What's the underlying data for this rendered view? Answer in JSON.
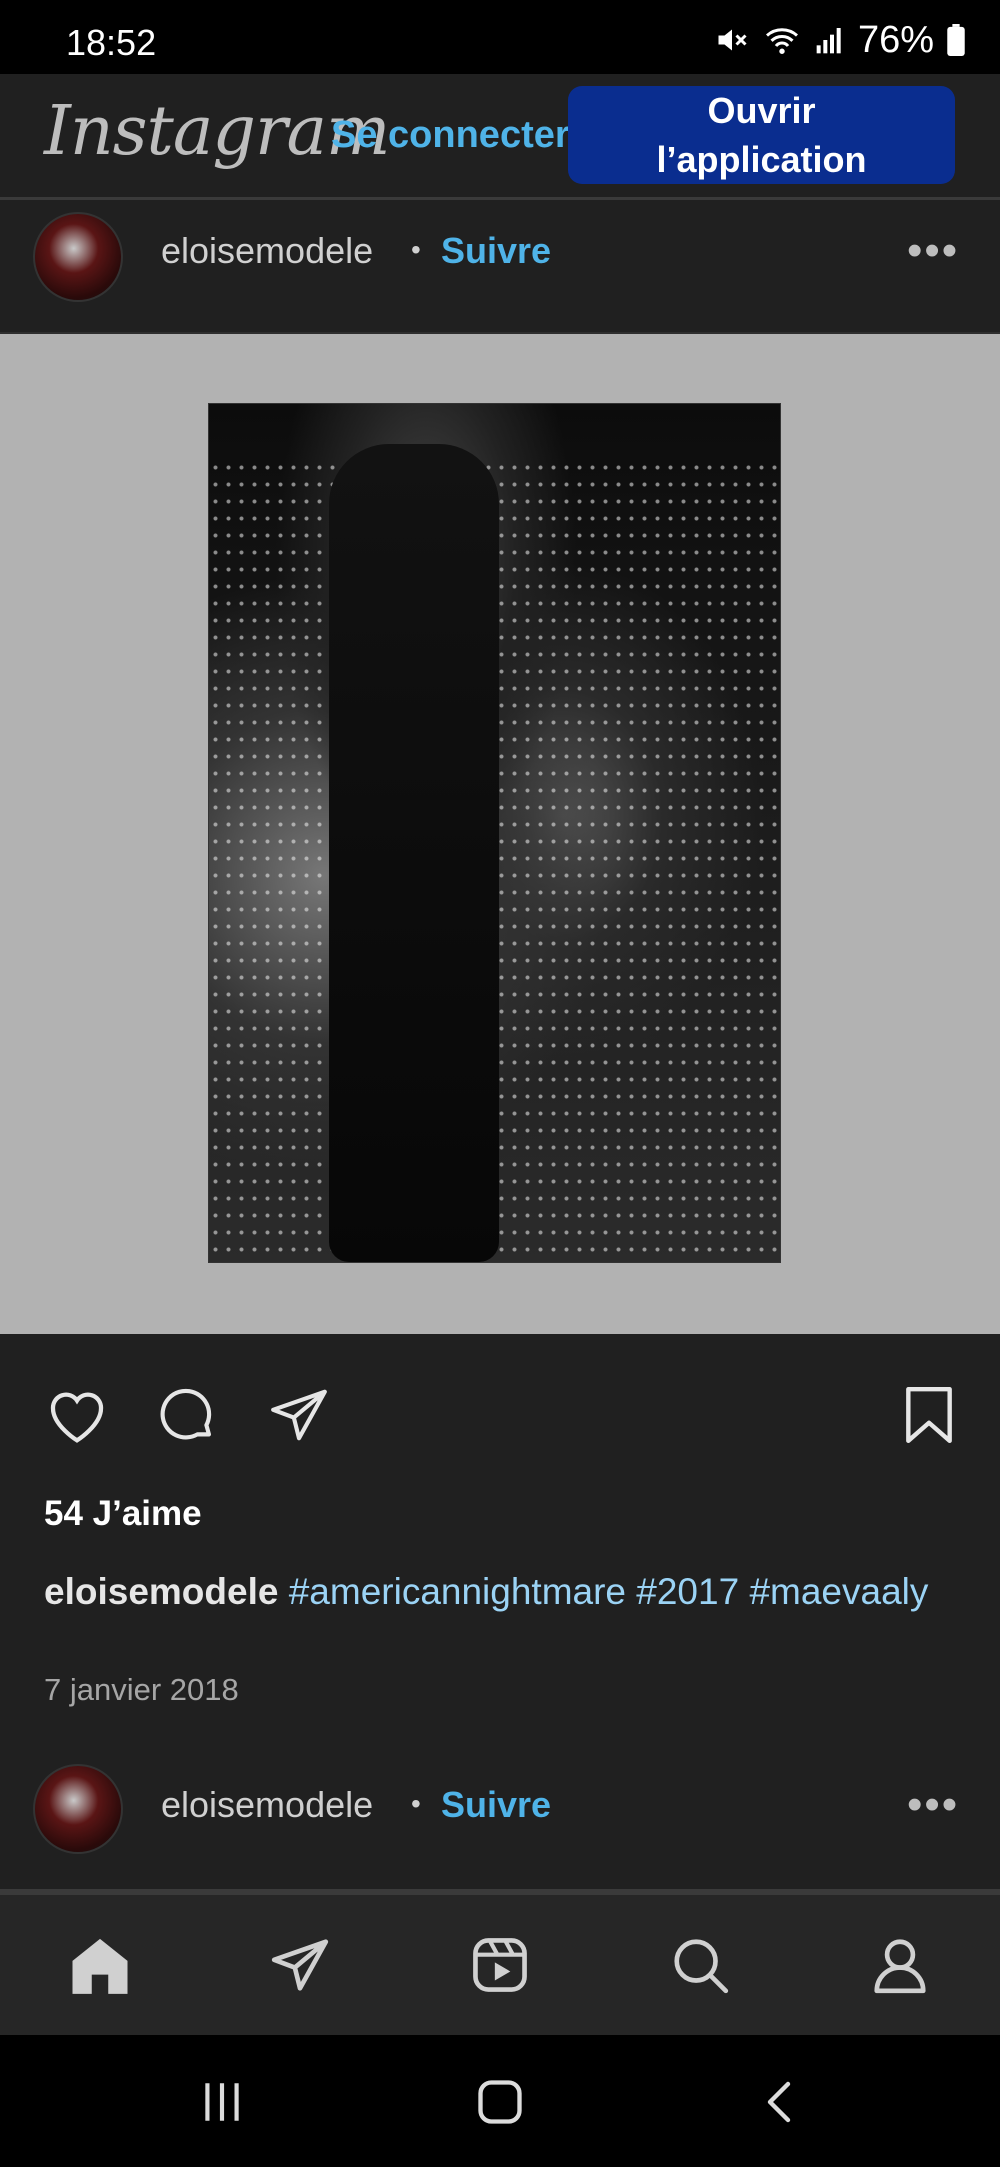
{
  "status_bar": {
    "time": "18:52",
    "battery": "76%",
    "icons": [
      "mute-icon",
      "wifi-icon",
      "signal-icon",
      "battery-icon"
    ]
  },
  "header": {
    "logo": "Instagram",
    "login_label": "Se connecter",
    "open_app_line1": "Ouvrir",
    "open_app_line2": "l’application"
  },
  "post": {
    "username": "eloisemodele",
    "separator": "•",
    "follow_label": "Suivre",
    "more": "•••",
    "likes": "54 J’aime",
    "caption_user": "eloisemodele",
    "caption_tags": "#americannightmare #2017 #maevaaly",
    "date": "7 janvier 2018"
  },
  "next_post": {
    "username": "eloisemodele",
    "separator": "•",
    "follow_label": "Suivre",
    "more": "•••"
  },
  "bottom_nav": [
    "home-icon",
    "direct-icon",
    "reels-icon",
    "search-icon",
    "profile-icon"
  ],
  "system_nav": [
    "recents-icon",
    "home-button-icon",
    "back-icon"
  ],
  "colors": {
    "accent": "#4fb3e8",
    "button": "#0a2d8f",
    "background": "#202020",
    "hashtag": "#9bd3f5"
  }
}
